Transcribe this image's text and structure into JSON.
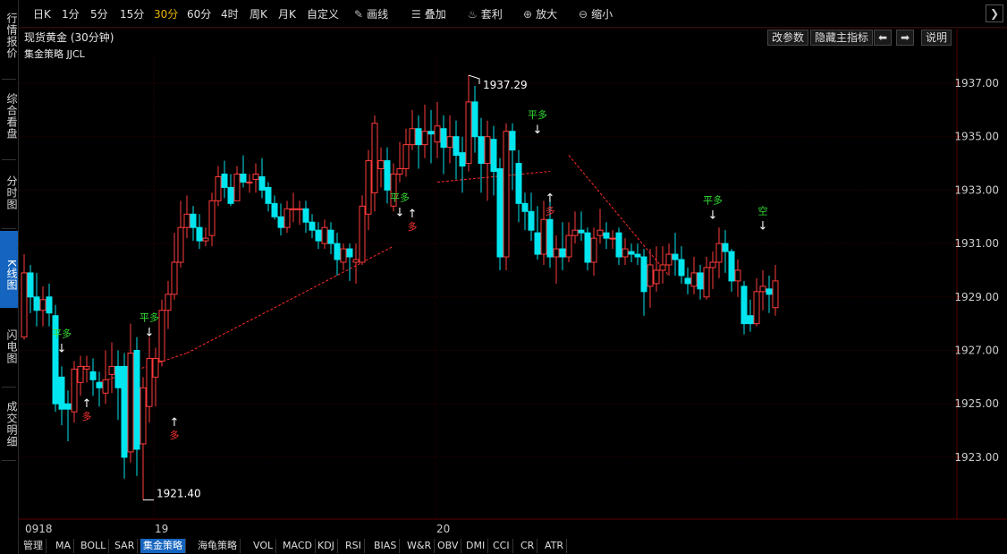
{
  "left_tabs": [
    {
      "label": "行情报价",
      "active": false
    },
    {
      "label": "综合看盘",
      "active": false
    },
    {
      "label": "分时图",
      "active": false
    },
    {
      "label": "K线图",
      "active": true
    },
    {
      "label": "闪电图",
      "active": false
    },
    {
      "label": "成交明细",
      "active": false
    }
  ],
  "toolbar": {
    "periods": [
      "日K",
      "1分",
      "5分",
      "15分",
      "30分",
      "60分",
      "4时",
      "周K",
      "月K",
      "自定义"
    ],
    "active_period": "30分",
    "tools": [
      {
        "label": "画线",
        "icon": "pencil-icon"
      },
      {
        "label": "叠加",
        "icon": "stack-icon"
      },
      {
        "label": "套利",
        "icon": "moneybag-icon"
      },
      {
        "label": "放大",
        "icon": "zoom-in-icon"
      },
      {
        "label": "缩小",
        "icon": "zoom-out-icon"
      }
    ],
    "next_label": "❯"
  },
  "header": {
    "title": "现货黄金 (30分钟)",
    "strategy": "集金策略 JJCL",
    "buttons": [
      "改参数",
      "隐藏主指标",
      "⬅",
      "➡",
      "说明"
    ]
  },
  "bottom_tabs": [
    "管理",
    "MA",
    "BOLL",
    "SAR",
    "集金策略",
    "海龟策略",
    "VOL",
    "MACD",
    "KDJ",
    "RSI",
    "BIAS",
    "W&R",
    "OBV",
    "DMI",
    "CCI",
    "CR",
    "ATR"
  ],
  "bottom_active": "集金策略",
  "colors": {
    "up": "#ff3b3b",
    "down": "#00e5ee",
    "grid": "#3a0000",
    "signal_green": "#33dd33",
    "signal_red": "#ff3333"
  },
  "chart_data": {
    "type": "candlestick",
    "y_ticks": [
      "1937.00",
      "1935.00",
      "1933.00",
      "1931.00",
      "1929.00",
      "1927.00",
      "1925.00",
      "1923.00"
    ],
    "ylim": [
      1922,
      1938
    ],
    "x_labels": [
      {
        "label": "0918",
        "index": 0
      },
      {
        "label": "19",
        "index": 21
      },
      {
        "label": "20",
        "index": 66
      }
    ],
    "max_label": "1937.29",
    "min_label": "1921.40",
    "candles": [
      [
        1927.5,
        1929.9,
        1930.6,
        1927.4
      ],
      [
        1929.9,
        1929.0,
        1930.2,
        1928.4
      ],
      [
        1929.0,
        1928.5,
        1929.9,
        1927.9
      ],
      [
        1928.5,
        1928.9,
        1929.4,
        1927.9
      ],
      [
        1929.0,
        1928.4,
        1929.5,
        1927.9
      ],
      [
        1928.3,
        1925.0,
        1928.7,
        1924.7
      ],
      [
        1926.0,
        1924.8,
        1926.4,
        1924.2
      ],
      [
        1925.0,
        1924.8,
        1925.5,
        1923.6
      ],
      [
        1924.7,
        1926.3,
        1926.6,
        1924.3
      ],
      [
        1925.8,
        1926.4,
        1926.8,
        1925.3
      ],
      [
        1926.3,
        1926.4,
        1926.8,
        1925.8
      ],
      [
        1926.2,
        1925.9,
        1926.7,
        1925.3
      ],
      [
        1925.8,
        1925.6,
        1926.2,
        1924.9
      ],
      [
        1925.4,
        1925.9,
        1927.0,
        1925.0
      ],
      [
        1926.1,
        1926.4,
        1927.3,
        1925.4
      ],
      [
        1926.4,
        1925.6,
        1927.0,
        1924.4
      ],
      [
        1926.4,
        1923.0,
        1926.9,
        1922.2
      ],
      [
        1923.2,
        1926.9,
        1928.0,
        1922.8
      ],
      [
        1927.0,
        1923.3,
        1927.5,
        1922.3
      ],
      [
        1923.5,
        1925.6,
        1926.0,
        1921.4
      ],
      [
        1924.9,
        1926.7,
        1927.5,
        1924.3
      ],
      [
        1926.0,
        1926.7,
        1927.1,
        1924.9
      ],
      [
        1926.6,
        1928.5,
        1928.9,
        1926.4
      ],
      [
        1928.5,
        1929.1,
        1929.6,
        1927.8
      ],
      [
        1929.1,
        1930.3,
        1931.4,
        1928.9
      ],
      [
        1930.3,
        1931.6,
        1932.6,
        1930.1
      ],
      [
        1931.6,
        1932.1,
        1932.8,
        1931.2
      ],
      [
        1932.1,
        1931.6,
        1932.4,
        1931.1
      ],
      [
        1931.6,
        1931.1,
        1932.1,
        1930.8
      ],
      [
        1931.1,
        1931.2,
        1931.6,
        1930.9
      ],
      [
        1931.3,
        1932.6,
        1932.9,
        1930.9
      ],
      [
        1932.6,
        1933.5,
        1933.9,
        1932.4
      ],
      [
        1933.6,
        1933.1,
        1934.1,
        1932.7
      ],
      [
        1933.1,
        1932.5,
        1933.6,
        1932.4
      ],
      [
        1932.6,
        1933.6,
        1933.9,
        1932.6
      ],
      [
        1933.6,
        1933.3,
        1934.3,
        1933.1
      ],
      [
        1933.3,
        1933.3,
        1933.6,
        1932.9
      ],
      [
        1933.4,
        1933.6,
        1934.0,
        1932.9
      ],
      [
        1933.5,
        1933.0,
        1934.2,
        1932.7
      ],
      [
        1933.1,
        1932.5,
        1933.3,
        1932.2
      ],
      [
        1932.5,
        1932.0,
        1932.8,
        1931.9
      ],
      [
        1932.0,
        1931.6,
        1932.5,
        1931.3
      ],
      [
        1931.6,
        1932.3,
        1932.6,
        1931.4
      ],
      [
        1932.3,
        1932.3,
        1932.9,
        1931.8
      ],
      [
        1932.3,
        1932.3,
        1932.6,
        1931.7
      ],
      [
        1932.3,
        1931.8,
        1932.6,
        1931.4
      ],
      [
        1931.8,
        1931.5,
        1932.1,
        1931.2
      ],
      [
        1931.5,
        1931.1,
        1931.8,
        1930.8
      ],
      [
        1931.0,
        1931.6,
        1931.9,
        1930.8
      ],
      [
        1931.5,
        1931.0,
        1931.8,
        1930.6
      ],
      [
        1931.0,
        1930.4,
        1931.4,
        1929.8
      ],
      [
        1930.3,
        1930.8,
        1931.0,
        1930.0
      ],
      [
        1930.8,
        1930.5,
        1931.0,
        1929.6
      ],
      [
        1930.3,
        1930.4,
        1931.0,
        1929.5
      ],
      [
        1930.3,
        1932.4,
        1932.8,
        1930.2
      ],
      [
        1932.1,
        1934.1,
        1934.5,
        1931.5
      ],
      [
        1932.9,
        1935.5,
        1935.8,
        1932.2
      ],
      [
        1933.8,
        1934.1,
        1934.6,
        1933.1
      ],
      [
        1934.1,
        1933.0,
        1934.6,
        1932.5
      ],
      [
        1932.4,
        1933.6,
        1934.0,
        1932.2
      ],
      [
        1933.6,
        1933.8,
        1934.8,
        1933.3
      ],
      [
        1933.8,
        1934.7,
        1935.3,
        1933.5
      ],
      [
        1934.7,
        1935.3,
        1936.0,
        1934.5
      ],
      [
        1935.3,
        1934.7,
        1935.8,
        1933.8
      ],
      [
        1934.7,
        1935.2,
        1936.2,
        1934.2
      ],
      [
        1935.2,
        1935.1,
        1936.0,
        1934.0
      ],
      [
        1934.8,
        1935.4,
        1936.3,
        1934.2
      ],
      [
        1935.3,
        1934.6,
        1935.8,
        1933.6
      ],
      [
        1934.6,
        1935.0,
        1935.8,
        1934.0
      ],
      [
        1935.0,
        1934.3,
        1935.6,
        1933.4
      ],
      [
        1934.4,
        1933.9,
        1935.0,
        1932.9
      ],
      [
        1934.0,
        1936.3,
        1937.3,
        1933.7
      ],
      [
        1936.3,
        1935.0,
        1936.9,
        1934.4
      ],
      [
        1935.0,
        1934.0,
        1935.7,
        1932.9
      ],
      [
        1934.0,
        1935.0,
        1935.6,
        1932.6
      ],
      [
        1934.9,
        1933.7,
        1935.4,
        1932.8
      ],
      [
        1933.8,
        1930.5,
        1934.2,
        1930.0
      ],
      [
        1930.5,
        1935.2,
        1935.5,
        1930.0
      ],
      [
        1935.2,
        1934.5,
        1935.5,
        1933.0
      ],
      [
        1934.0,
        1932.5,
        1934.5,
        1931.8
      ],
      [
        1932.5,
        1932.2,
        1932.9,
        1931.5
      ],
      [
        1932.2,
        1931.5,
        1932.9,
        1931.1
      ],
      [
        1931.4,
        1930.6,
        1932.4,
        1930.4
      ],
      [
        1930.6,
        1931.9,
        1932.6,
        1930.2
      ],
      [
        1931.9,
        1930.5,
        1932.6,
        1930.1
      ],
      [
        1930.5,
        1930.8,
        1931.3,
        1929.5
      ],
      [
        1930.8,
        1930.5,
        1931.8,
        1930.0
      ],
      [
        1930.5,
        1931.3,
        1931.8,
        1930.3
      ],
      [
        1931.3,
        1931.5,
        1932.2,
        1931.0
      ],
      [
        1931.5,
        1931.4,
        1932.2,
        1931.1
      ],
      [
        1931.4,
        1930.3,
        1931.6,
        1930.0
      ],
      [
        1930.3,
        1931.2,
        1931.6,
        1929.8
      ],
      [
        1931.3,
        1931.5,
        1932.3,
        1931.0
      ],
      [
        1931.4,
        1931.2,
        1931.8,
        1930.8
      ],
      [
        1931.2,
        1931.2,
        1931.5,
        1930.8
      ],
      [
        1931.4,
        1930.5,
        1931.6,
        1930.2
      ],
      [
        1930.5,
        1930.8,
        1931.2,
        1930.2
      ],
      [
        1930.7,
        1930.6,
        1931.0,
        1930.3
      ],
      [
        1930.6,
        1930.5,
        1931.0,
        1930.2
      ],
      [
        1930.5,
        1929.2,
        1930.8,
        1928.3
      ],
      [
        1929.4,
        1930.2,
        1930.8,
        1928.6
      ],
      [
        1929.5,
        1930.0,
        1930.9,
        1929.2
      ],
      [
        1930.0,
        1930.2,
        1930.9,
        1929.5
      ],
      [
        1930.2,
        1930.6,
        1931.0,
        1929.8
      ],
      [
        1930.6,
        1930.4,
        1931.4,
        1929.8
      ],
      [
        1930.4,
        1929.8,
        1930.9,
        1929.5
      ],
      [
        1929.7,
        1929.5,
        1930.1,
        1929.1
      ],
      [
        1929.4,
        1929.9,
        1930.5,
        1929.1
      ],
      [
        1929.9,
        1929.3,
        1930.2,
        1928.9
      ],
      [
        1929.0,
        1930.1,
        1930.5,
        1928.9
      ],
      [
        1930.1,
        1930.3,
        1930.7,
        1929.3
      ],
      [
        1930.3,
        1931.0,
        1931.6,
        1929.7
      ],
      [
        1931.0,
        1930.7,
        1931.5,
        1929.9
      ],
      [
        1930.7,
        1929.6,
        1930.8,
        1929.2
      ],
      [
        1929.6,
        1930.0,
        1930.4,
        1929.0
      ],
      [
        1929.4,
        1928.0,
        1929.6,
        1927.6
      ],
      [
        1928.3,
        1928.0,
        1928.9,
        1927.7
      ],
      [
        1928.0,
        1929.2,
        1929.7,
        1927.9
      ],
      [
        1929.2,
        1929.4,
        1930.0,
        1928.5
      ],
      [
        1929.3,
        1929.1,
        1929.8,
        1928.4
      ],
      [
        1928.6,
        1929.6,
        1930.2,
        1928.3
      ]
    ],
    "signals": [
      {
        "index": 6,
        "label": "平多",
        "type": "exit",
        "price": 1927.5
      },
      {
        "index": 10,
        "label": "多",
        "type": "long",
        "price": 1924.4
      },
      {
        "index": 20,
        "label": "平多",
        "type": "exit",
        "price": 1928.1
      },
      {
        "index": 24,
        "label": "多",
        "type": "long",
        "price": 1923.7
      },
      {
        "index": 60,
        "label": "平多",
        "type": "exit",
        "price": 1932.6
      },
      {
        "index": 62,
        "label": "多",
        "type": "long",
        "price": 1931.5
      },
      {
        "index": 82,
        "label": "平多",
        "type": "exit",
        "price": 1935.7
      },
      {
        "index": 84,
        "label": "多",
        "type": "long",
        "price": 1932.1
      },
      {
        "index": 110,
        "label": "平多",
        "type": "exit",
        "price": 1932.5
      },
      {
        "index": 118,
        "label": "空",
        "type": "short",
        "price": 1932.1
      }
    ],
    "trend_lines": [
      {
        "from": [
          12,
          1925.8
        ],
        "to": [
          26,
          1926.9
        ]
      },
      {
        "from": [
          26,
          1926.9
        ],
        "to": [
          59,
          1930.9
        ]
      },
      {
        "from": [
          66,
          1933.3
        ],
        "to": [
          84,
          1933.7
        ]
      },
      {
        "from": [
          87,
          1934.3
        ],
        "to": [
          103,
          1929.8
        ]
      }
    ]
  }
}
